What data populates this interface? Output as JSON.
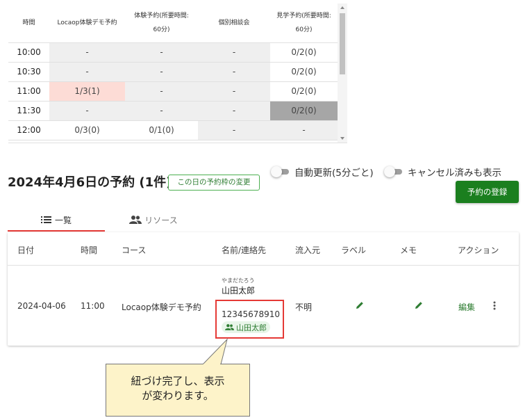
{
  "slot_table": {
    "headers": [
      "時間",
      "Locaop体験デモ予約",
      "体験予約(所要時間: 60分)",
      "個別相談会",
      "見学予約(所要時間: 60分)"
    ],
    "rows": [
      {
        "time": "10:00",
        "c1": "-",
        "c2": "-",
        "c3": "-",
        "c4": "0/2(0)"
      },
      {
        "time": "10:30",
        "c1": "-",
        "c2": "-",
        "c3": "-",
        "c4": "0/2(0)"
      },
      {
        "time": "11:00",
        "c1": "1/3(1)",
        "c2": "-",
        "c3": "-",
        "c4": "0/2(0)"
      },
      {
        "time": "11:30",
        "c1": "-",
        "c2": "-",
        "c3": "-",
        "c4": "0/2(0)"
      },
      {
        "time": "12:00",
        "c1": "0/3(0)",
        "c2": "0/1(0)",
        "c3": "-",
        "c4": "-"
      }
    ]
  },
  "day": {
    "title": "2024年4月6日の予約 (1件)",
    "change_button": "この日の予約枠の変更",
    "auto_refresh_label": "自動更新(5分ごと)",
    "show_cancelled_label": "キャンセル済みも表示",
    "register_button": "予約の登録"
  },
  "tabs": {
    "list": "一覧",
    "resource": "リソース"
  },
  "reservations": {
    "columns": {
      "date": "日付",
      "time": "時間",
      "course": "コース",
      "name_contact": "名前/連絡先",
      "source": "流入元",
      "label": "ラベル",
      "memo": "メモ",
      "action": "アクション"
    },
    "row": {
      "date": "2024-04-06",
      "time": "11:00",
      "course": "Locaop体験デモ予約",
      "kana": "やまだたろう",
      "name": "山田太郎",
      "phone": "12345678910",
      "linked_customer": "山田太郎",
      "source": "不明",
      "edit": "編集"
    }
  },
  "callout": {
    "line1": "紐づけ完了し、表示",
    "line2": "が変わります。"
  },
  "colors": {
    "brand_green": "#1b7f1f",
    "highlight_red": "#e53935",
    "pink_cell": "#fddcd6",
    "callout_bg": "#fdf3c9"
  }
}
